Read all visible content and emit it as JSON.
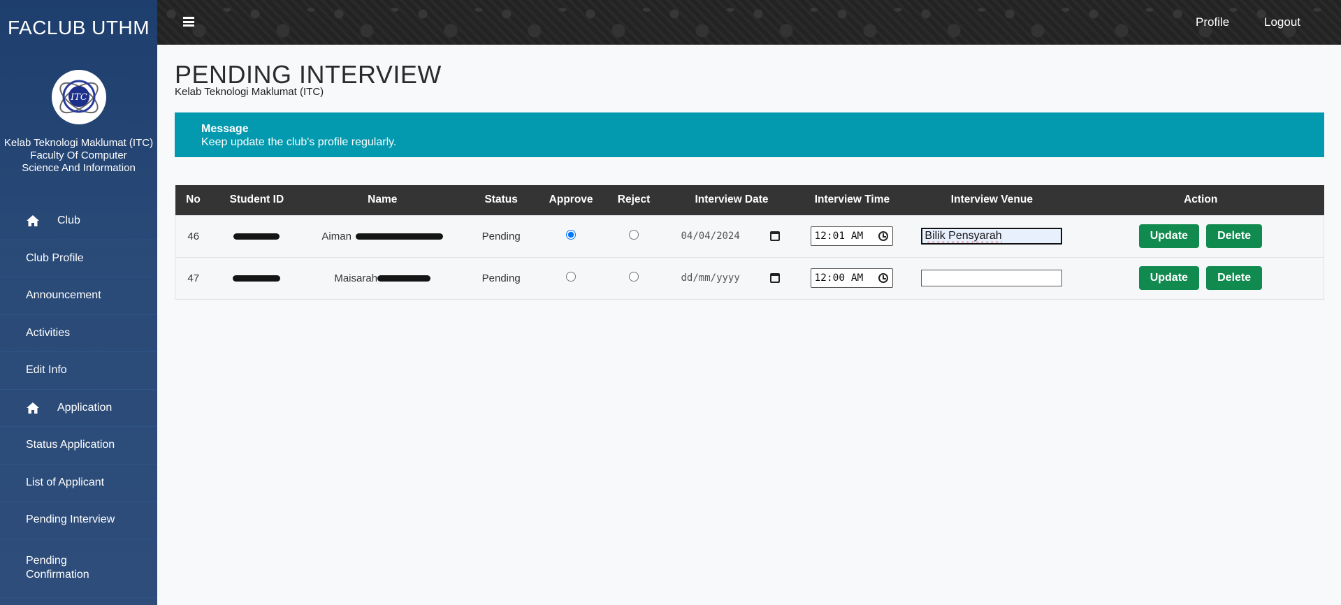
{
  "sidebar": {
    "brand": "FACLUB UTHM",
    "club_name": "Kelab Teknologi Maklumat (ITC)",
    "faculty": "Faculty Of Computer Science And Information",
    "logo_text": "ITC",
    "items": [
      {
        "label": "Club",
        "icon": "home-icon"
      },
      {
        "label": "Club Profile"
      },
      {
        "label": "Announcement"
      },
      {
        "label": "Activities"
      },
      {
        "label": "Edit Info"
      },
      {
        "label": "Application",
        "icon": "home-icon"
      },
      {
        "label": "Status Application"
      },
      {
        "label": "List of Applicant"
      },
      {
        "label": "Pending Interview"
      },
      {
        "label": "Pending Confirmation"
      }
    ]
  },
  "topbar": {
    "menu_icon": "hamburger-icon",
    "profile": "Profile",
    "logout": "Logout"
  },
  "page": {
    "title": "PENDING INTERVIEW",
    "subtitle": "Kelab Teknologi Maklumat (ITC)"
  },
  "alert": {
    "title": "Message",
    "text": "Keep update the club's profile regularly.",
    "color": "#0399ae"
  },
  "table": {
    "headers": [
      "No",
      "Student ID",
      "Name",
      "Status",
      "Approve",
      "Reject",
      "Interview Date",
      "Interview Time",
      "Interview Venue",
      "Action"
    ],
    "rows": [
      {
        "no": "46",
        "name_visible": "Aiman",
        "status": "Pending",
        "approve": true,
        "reject": false,
        "date": "04/04/2024",
        "time": "12:01 AM",
        "venue": "Bilik Pensyarah"
      },
      {
        "no": "47",
        "name_visible": "Maisarah",
        "status": "Pending",
        "approve": false,
        "reject": false,
        "date": "dd/mm/yyyy",
        "time": "12:00 AM",
        "venue": ""
      }
    ],
    "update_label": "Update",
    "delete_label": "Delete",
    "button_color": "#118a4f"
  }
}
